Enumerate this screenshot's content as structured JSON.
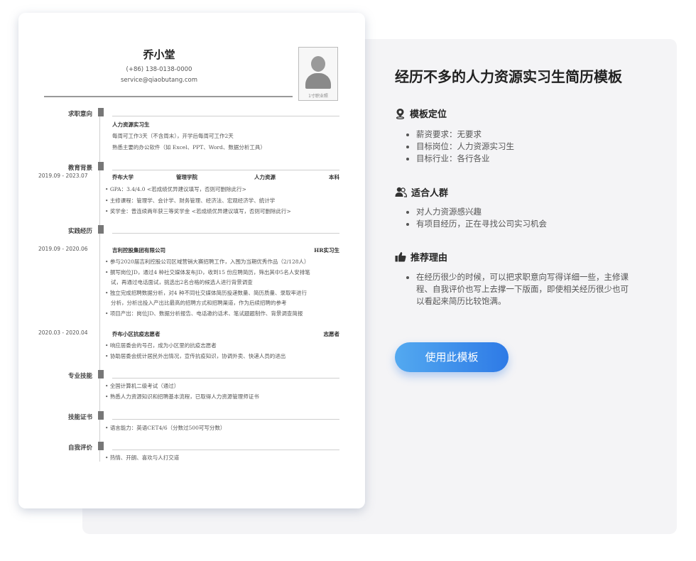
{
  "resume": {
    "name": "乔小堂",
    "phone": "(+86) 138-0138-0000",
    "email": "service@qiaobutang.com",
    "photo_caption": "1寸职业照",
    "sections": {
      "intent": {
        "label": "求职意向",
        "lines": [
          "人力资源实习生",
          "每周可工作3天（不含周末），开学后每周可工作2天",
          "熟悉主要的办公软件（如 Excel、PPT、Word、数据分析工具）"
        ]
      },
      "education": {
        "label": "教育背景",
        "date": "2019.09 - 2023.07",
        "school": "乔布大学",
        "college": "管理学院",
        "major": "人力资源",
        "degree": "本科",
        "bullets": [
          "GPA：3.4/4.0 <若成绩优异建议填写，否则可删除此行>",
          "主修课程：管理学、会计学、财务管理、经济法、宏观经济学、统计学",
          "奖学金：曾连续两年获三等奖学金 <若成绩优异建议填写，否则可删除此行>"
        ]
      },
      "practice": {
        "label": "实践经历",
        "date1": "2019.09 - 2020.06",
        "org1": "吉利控股集团有限公司",
        "role1": "HR实习生",
        "bullets1": [
          "参与2020届吉利控股公司区域营销大赛招聘工作，入围为当期优秀作品（2/128人）",
          "撰写岗位JD，通过4 种社交媒体发布JD，收到15 份应聘简历，筛出其中5名人安排笔",
          "试，再通过电话面试，挑选出2名合格的候选人进行背景调查",
          "独立完成招聘数据分析，对4 种不同社交媒体简历投递数量、简历质量、录取率进行",
          "分析，分析出投入产出比最高的招聘方式和招聘渠道，作为后续招聘的参考",
          "项目产出：岗位JD、数据分析报告、电话邀约话术、笔试题题制作、背景调查简报"
        ],
        "date2": "2020.03 - 2020.04",
        "org2": "乔布小区抗疫志愿者",
        "role2": "志愿者",
        "bullets2": [
          "响应居委会的号召，成为小区里的抗疫志愿者",
          "协助居委会统计居民外出情况，宣传抗疫知识，协调外卖、快递人员的进出"
        ]
      },
      "skills": {
        "label": "专业技能",
        "bullets": [
          "全国计算机二级考试（通过）",
          "熟悉人力资源知识和招聘基本流程，已取得人力资源管理师证书"
        ]
      },
      "certs": {
        "label": "技能证书",
        "bullets": [
          "语言能力：英语CET4/6（分数过500可写分数）"
        ]
      },
      "self": {
        "label": "自我评价",
        "bullets": [
          "热情、开朗、喜欢与人打交道"
        ]
      }
    }
  },
  "info": {
    "title": "经历不多的人力资源实习生简历模板",
    "positioning": {
      "heading": "模板定位",
      "icon": "location-pin-icon",
      "items": [
        "薪资要求：无要求",
        "目标岗位：人力资源实习生",
        "目标行业：各行各业"
      ]
    },
    "audience": {
      "heading": "适合人群",
      "icon": "users-icon",
      "items": [
        "对人力资源感兴趣",
        "有项目经历，正在寻找公司实习机会"
      ]
    },
    "reason": {
      "heading": "推荐理由",
      "icon": "thumbs-up-icon",
      "items": [
        "在经历很少的时候，可以把求职意向写得详细一些，主修课程、自我评价也写上去撑一下版面，即使相关经历很少也可以看起来简历比较饱满。"
      ]
    },
    "use_button": "使用此模板"
  },
  "colors": {
    "accent_start": "#53a9f0",
    "accent_end": "#2e7ae6",
    "panel_bg": "#f4f4f6"
  }
}
